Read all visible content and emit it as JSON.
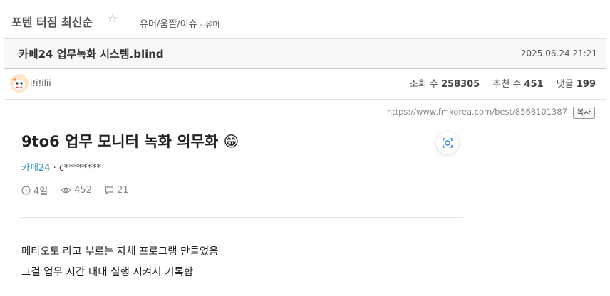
{
  "board": {
    "title": "포텐 터짐 최신순",
    "category": "유머/움짤/이슈",
    "subcategory": "- 유머"
  },
  "post": {
    "title": "카페24 업무녹화 시스템.blind",
    "date": "2025.06.24 21:21",
    "author": "i!i!ilii",
    "stats": {
      "views_label": "조회 수",
      "views": "258305",
      "votes_label": "추천 수",
      "votes": "451",
      "comments_label": "댓글",
      "comments": "199"
    },
    "url": "https://www.fmkorea.com/best/8568101387",
    "copy_label": "복사"
  },
  "article": {
    "title": "9to6 업무 모니터 녹화 의무화",
    "emoji": "😁",
    "company": "카페24",
    "byline_sep": " · ",
    "writer": "c********",
    "age": "4일",
    "views": "452",
    "comments": "21",
    "body": [
      "메타오토 라고 부르는 자체 프로그램 만들었음",
      "그걸 업무 시간 내내 실행 시켜서 기록함"
    ]
  },
  "colors": {
    "company_link": "#2d8fb8",
    "title_bar_bg": "#f8f8f8"
  }
}
